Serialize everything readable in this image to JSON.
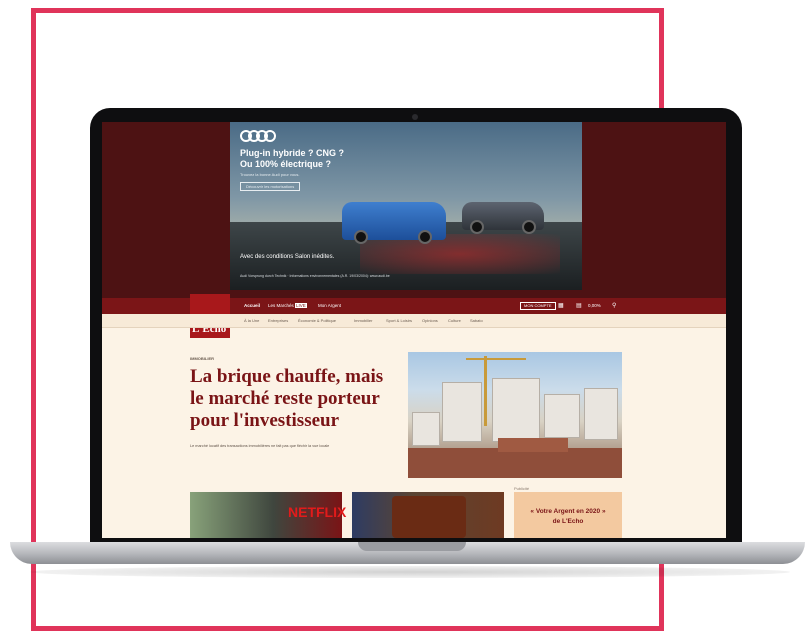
{
  "ad": {
    "headline": [
      "Plug-in hybride ? CNG ?",
      "Ou 100% électrique ?"
    ],
    "subline": "Trouvez la bonne Audi pour vous.",
    "cta": "Découvrir les motorisations",
    "note": "Avec des conditions Salon inédites.",
    "footer": "Audi Vorsprung durch Technik · Informations environnementales (A.R. 19/03/2004): www.audi.be"
  },
  "nav": {
    "items": [
      "Accueil",
      "Les Marchés",
      "Mon Argent"
    ],
    "new_tag": "LIVE",
    "account_button": "MON COMPTE",
    "icons": [
      "grid-icon",
      "newspaper-icon",
      "search-icon"
    ],
    "index_value": "0,00%"
  },
  "logo": {
    "text": "L'Echo"
  },
  "subnav": {
    "items": [
      "À la Une",
      "Entreprises",
      "Économie & Politique",
      "Immobilier",
      "Sport & Loisirs",
      "Opinions",
      "Culture",
      "Sabato"
    ]
  },
  "article": {
    "kicker": "IMMOBILIER",
    "headline": [
      "La brique chauffe, mais",
      "le marché reste porteur",
      "pour l'investisseur"
    ],
    "lede": "Le marché locatif des transactions immobilières ne fait pas que fléchir la vue locale"
  },
  "promo": {
    "label": "Publicité",
    "lines": [
      "« Votre Argent en 2020 »",
      "de L'Echo"
    ]
  },
  "thumbs": {
    "netflix_text": "NETFLIX"
  },
  "colors": {
    "frame": "#e0345a",
    "brand": "#a8181b",
    "nav": "#7b1517",
    "ad_band": "#4d1213",
    "page_bg": "#fcf3e6"
  }
}
